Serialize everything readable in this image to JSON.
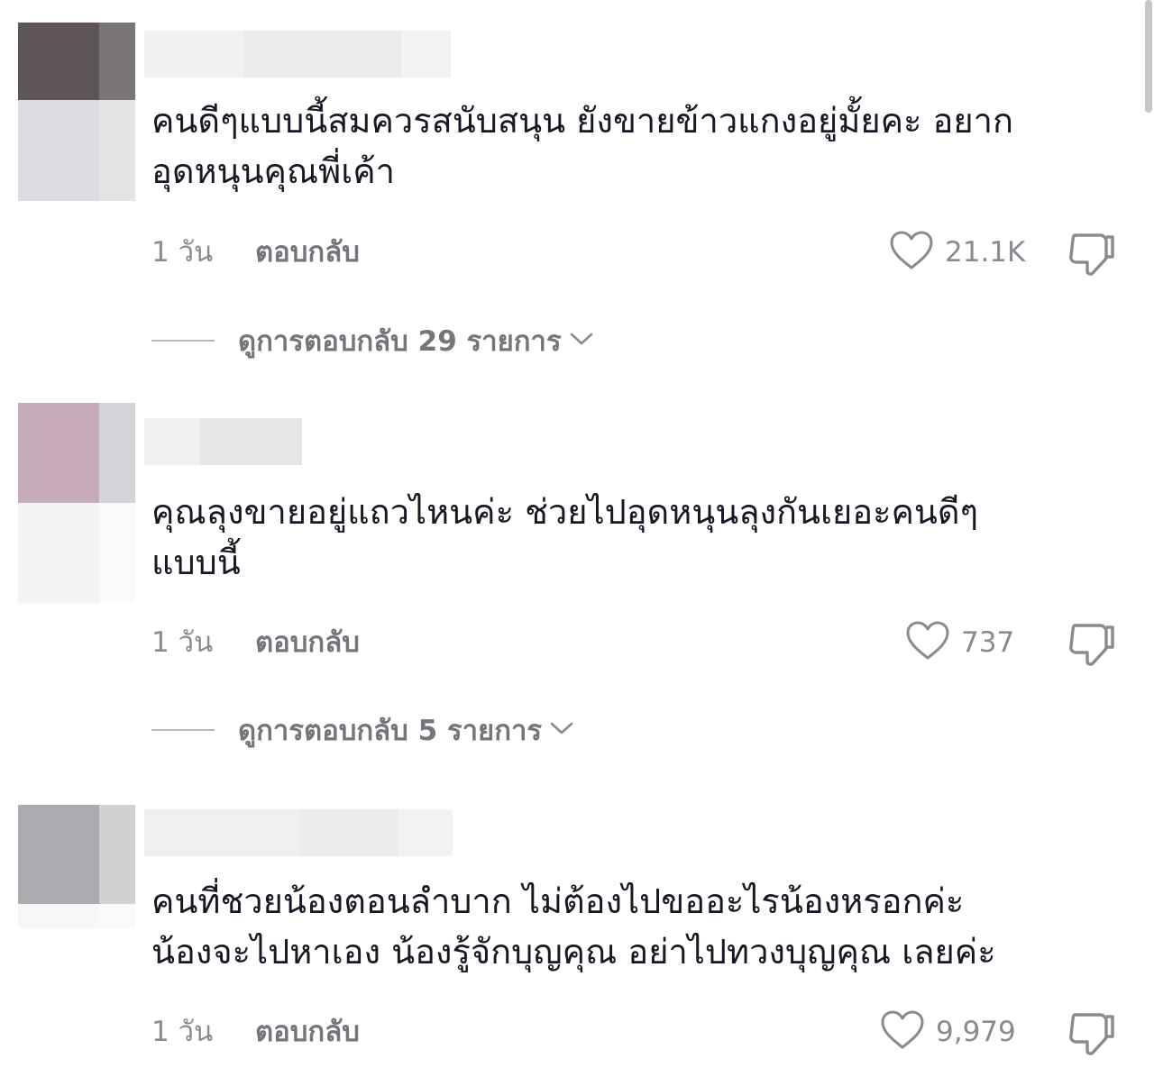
{
  "comments": [
    {
      "text": "คนดีๆแบบนี้สมควรสนับสนุน ยังขายข้าวแกงอยู่มั้ยคะ อยาก\nอุดหนุนคุณพี่เค้า",
      "time": "1 วัน",
      "reply_label": "ตอบกลับ",
      "likes": "21.1K",
      "view_replies": "ดูการตอบกลับ 29 รายการ",
      "avatar_colors": [
        "#5e555b",
        "#7a7579",
        "#dcdbe0",
        "#e4e4e6"
      ],
      "username_colors": [
        "#f1f1f2",
        "#ececee",
        "#f3f3f4"
      ]
    },
    {
      "text": "คุณลุงขายอยู่แถวไหนค่ะ ช่วยไปอุดหนุนลุงกันเยอะคนดีๆ\nแบบนี้",
      "time": "1 วัน",
      "reply_label": "ตอบกลับ",
      "likes": "737",
      "view_replies": "ดูการตอบกลับ 5 รายการ",
      "avatar_colors": [
        "#c6acba",
        "#d5d3da",
        "#f6f3f3",
        "#fafafa"
      ],
      "username_colors": [
        "#f0f0f1",
        "#e6e6e7"
      ]
    },
    {
      "text": "คนที่ชวยน้องตอนลำบาก ไม่ต้องไปขออะไรน้องหรอกค่ะ\nน้องจะไปหาเอง น้องรู้จักบุญคุณ อย่าไปทวงบุญคุณ เลยค่ะ",
      "time": "1 วัน",
      "reply_label": "ตอบกลับ",
      "likes": "9,979",
      "avatar_colors": [
        "#abacb0",
        "#d1d1d3",
        "#f7f7f8",
        "#fafafa"
      ],
      "username_colors": [
        "#f0f0f1",
        "#ececed",
        "#f2f2f3"
      ]
    }
  ],
  "colors": {
    "text": "#161823",
    "muted": "#8a8b91",
    "reply": "#75767c"
  },
  "icons": [
    "heart-icon",
    "dislike-icon",
    "chevron-down-icon"
  ]
}
